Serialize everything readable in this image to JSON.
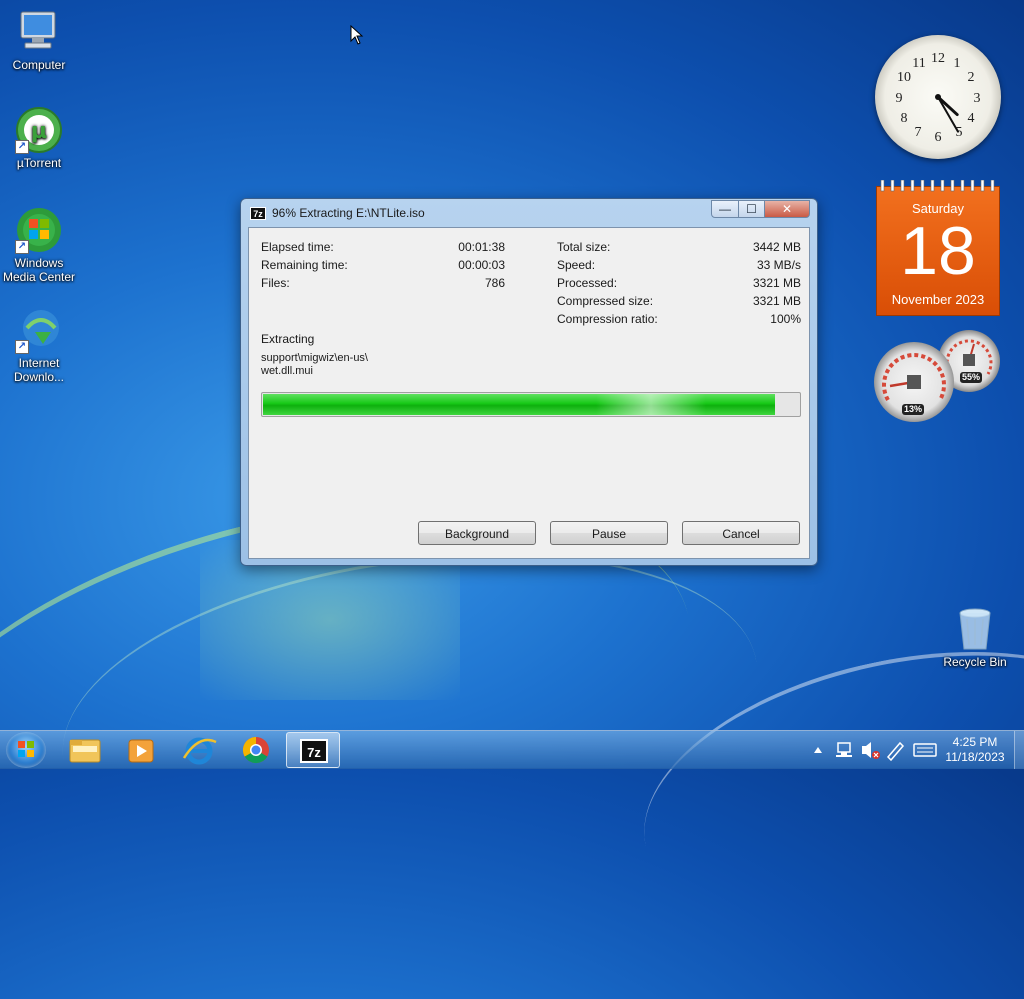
{
  "desktop": {
    "icons": [
      {
        "label": "Computer",
        "icon": "computer-icon"
      },
      {
        "label": "µTorrent",
        "icon": "utorrent-icon"
      },
      {
        "label": "Windows Media Center",
        "icon": "windows-media-center-icon"
      },
      {
        "label": "Internet Downlo...",
        "icon": "internet-download-manager-icon"
      },
      {
        "label": "Recycle Bin",
        "icon": "recycle-bin-icon"
      }
    ]
  },
  "dialog": {
    "title": "96% Extracting E:\\NTLite.iso",
    "app_icon_text": "7z",
    "controls": {
      "minimize": "—",
      "maximize": "☐",
      "close": "✕"
    },
    "stats_left": [
      {
        "label": "Elapsed time:",
        "value": "00:01:38"
      },
      {
        "label": "Remaining time:",
        "value": "00:00:03"
      },
      {
        "label": "Files:",
        "value": "786"
      }
    ],
    "stats_right": [
      {
        "label": "Total size:",
        "value": "3442 MB"
      },
      {
        "label": "Speed:",
        "value": "33 MB/s"
      },
      {
        "label": "Processed:",
        "value": "3321 MB"
      },
      {
        "label": "Compressed size:",
        "value": "3321 MB"
      },
      {
        "label": "Compression ratio:",
        "value": "100%"
      }
    ],
    "status_label": "Extracting",
    "current_path": "support\\migwiz\\en-us\\",
    "current_file": "wet.dll.mui",
    "progress_fraction": 0.96,
    "buttons": {
      "background": "Background",
      "pause": "Pause",
      "cancel": "Cancel"
    }
  },
  "gadgets": {
    "clock": {
      "hour": 4,
      "minute": 25
    },
    "calendar": {
      "weekday": "Saturday",
      "day": "18",
      "month_year": "November 2023"
    },
    "cpu_meter": {
      "cpu": "13%",
      "memory": "55%"
    }
  },
  "taskbar": {
    "pinned": [
      "start-orb-icon",
      "file-explorer-icon",
      "media-player-icon",
      "internet-explorer-icon",
      "chrome-icon",
      "7zip-icon"
    ],
    "tray": {
      "time": "4:25 PM",
      "date": "11/18/2023"
    }
  },
  "colors": {
    "accent_progress": "#17c917",
    "calendar": "#e35c10"
  }
}
